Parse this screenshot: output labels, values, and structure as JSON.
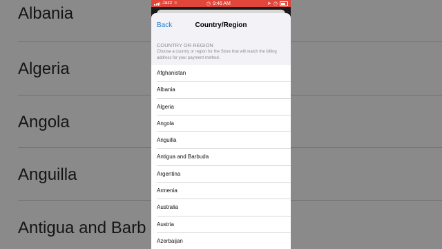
{
  "background": {
    "items": [
      "Albania",
      "Algeria",
      "Angola",
      "Anguilla",
      "Antigua and Barb"
    ]
  },
  "status_bar": {
    "carrier": "Jazz",
    "time": "9:46 AM"
  },
  "nav": {
    "back_label": "Back",
    "title": "Country/Region"
  },
  "section": {
    "header": "COUNTRY OR REGION",
    "description": "Choose a country or region for the Store that will match the billing address for your payment method."
  },
  "countries": [
    "Afghanistan",
    "Albania",
    "Algeria",
    "Angola",
    "Anguilla",
    "Antigua and Barbuda",
    "Argentina",
    "Armenia",
    "Australia",
    "Austria",
    "Azerbaijan"
  ],
  "colors": {
    "accent": "#1b7fd3",
    "status_bar": "#e2453a",
    "sheet_bg": "#f2f2f7"
  }
}
